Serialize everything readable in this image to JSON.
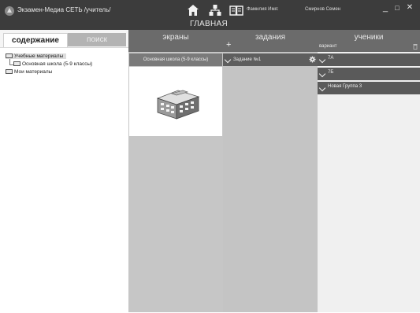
{
  "titlebar": {
    "app_title": "Экзамен-Медиа СЕТЬ /учитель/",
    "page_title": "ГЛАВНАЯ",
    "user_label": "Фамилия Имя:",
    "user_name": "Смирнов Семен",
    "minimize": "_",
    "maximize": "□",
    "close": "✕",
    "nav_icons": [
      "home-icon",
      "network-icon",
      "book-icon"
    ]
  },
  "sidebar": {
    "tabs": [
      {
        "label": "содержание",
        "active": true
      },
      {
        "label": "поиск",
        "active": false
      }
    ],
    "tree": [
      {
        "label": "Учебные материалы"
      },
      {
        "label": "Основная школа (5-9 классы)"
      },
      {
        "label": "Мои материалы"
      }
    ]
  },
  "columns": {
    "screens": {
      "title": "экраны",
      "item": "Основная школа (5-9 классы)"
    },
    "tasks": {
      "title": "задания",
      "add": "+",
      "item": "Задание №1"
    },
    "students": {
      "title": "ученики",
      "variant_label": "вариант",
      "groups": [
        "7А",
        "7Б",
        "Новая Группа 3"
      ]
    }
  },
  "colors": {
    "titlebar": "#3c3c3c",
    "column_header": "#6b6b6b",
    "task_row": "#5e5e5e",
    "panel_gray": "#c6c6c6"
  }
}
